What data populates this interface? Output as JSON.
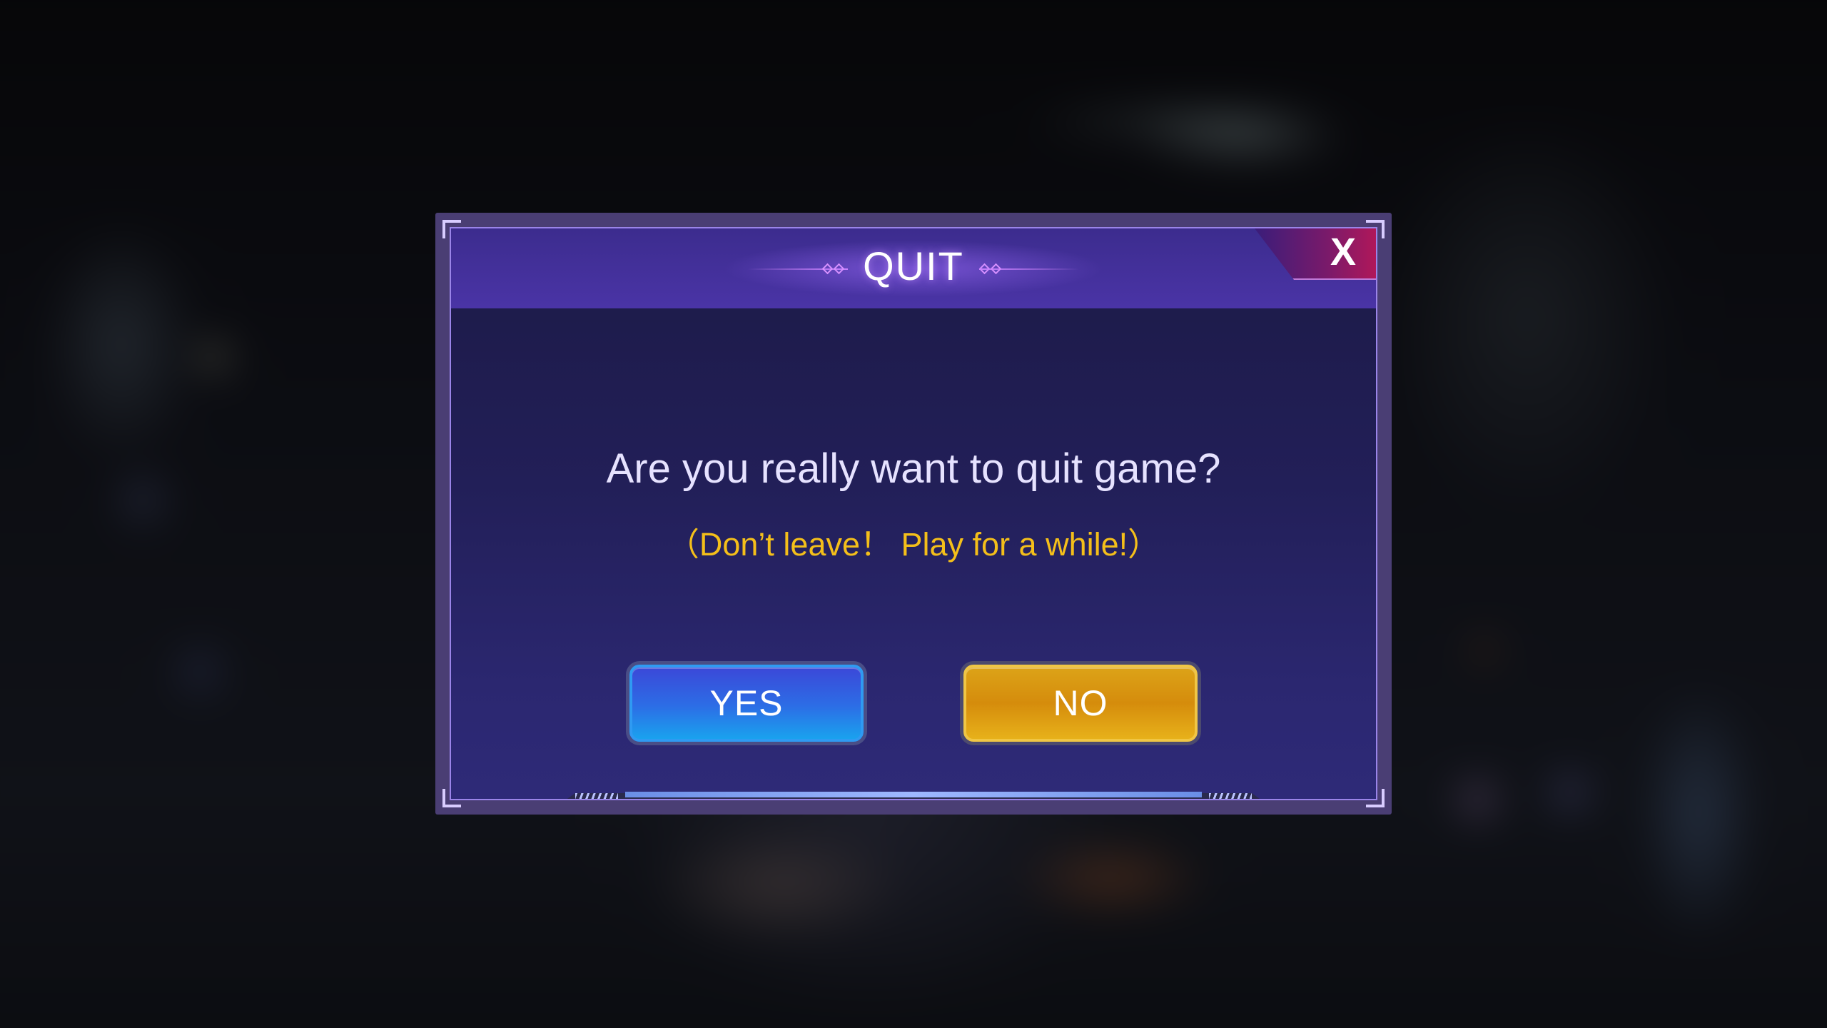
{
  "dialog": {
    "title": "QUIT",
    "close_label": "X",
    "message": "Are you really want to quit game?",
    "sub_message": "（Don’t leave！ Play for a while!）",
    "yes_label": "YES",
    "no_label": "NO"
  },
  "icons": {
    "close": "close-icon",
    "title_ornament_left": "diamond-ornament-icon",
    "title_ornament_right": "diamond-ornament-icon"
  },
  "colors": {
    "accent_purple": "#4a34a6",
    "message_text": "#e6e2ff",
    "sub_message_text": "#f4bf1a",
    "yes_button": "#2c6ee6",
    "no_button": "#d58c0c",
    "close_tab": "#b0185a"
  }
}
